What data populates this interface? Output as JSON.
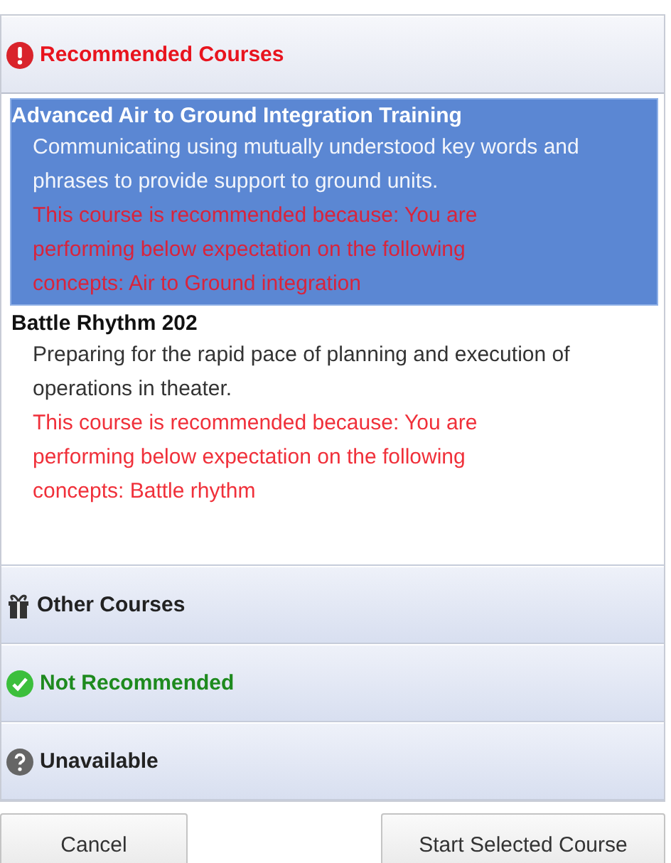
{
  "sections": [
    {
      "kind": "recommended",
      "title": "Recommended Courses",
      "expanded": true,
      "courses": [
        {
          "name": "Advanced Air to Ground Integration Training",
          "description": "Communicating using mutually understood key words and phrases to provide support to ground units.",
          "reason": "This course is recommended because: You are performing below expectation on the following concepts: Air to Ground integration",
          "selected": true
        },
        {
          "name": "Battle Rhythm 202",
          "description": "Preparing for the rapid pace of planning and execution of operations in theater.",
          "reason": "This course is recommended because: You are performing below expectation on the following concepts: Battle rhythm",
          "selected": false
        }
      ]
    },
    {
      "kind": "other",
      "title": "Other Courses",
      "expanded": false
    },
    {
      "kind": "not_recommended",
      "title": "Not Recommended",
      "expanded": false
    },
    {
      "kind": "unavailable",
      "title": "Unavailable",
      "expanded": false
    }
  ],
  "buttons": [
    {
      "label": "Cancel"
    },
    {
      "label": "Start Selected Course"
    }
  ]
}
